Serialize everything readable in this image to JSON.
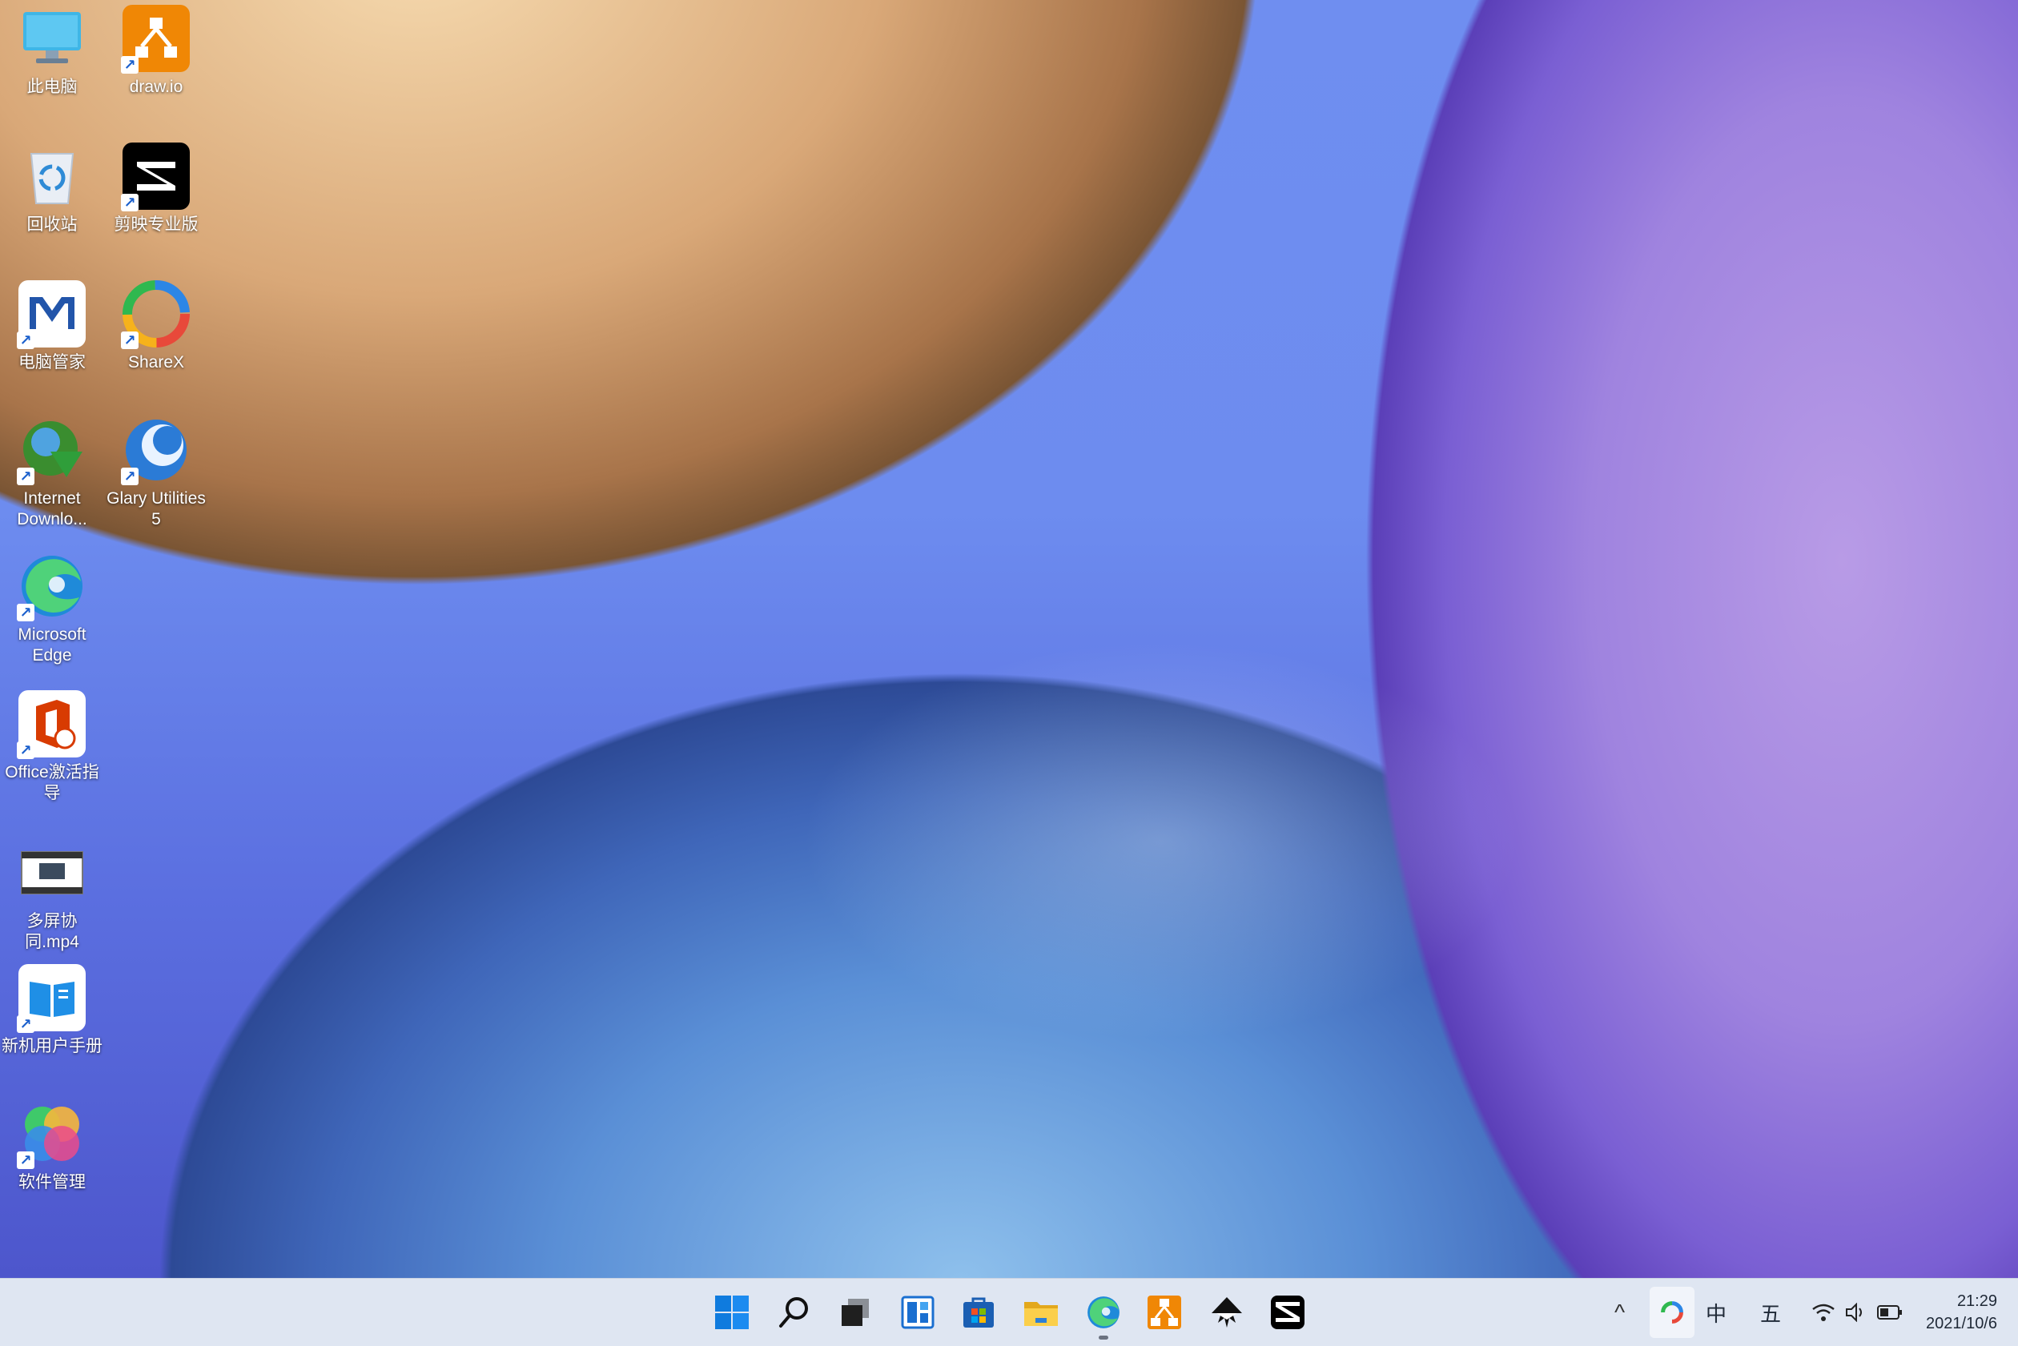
{
  "desktop": {
    "icons": [
      {
        "label": "此电脑",
        "icon": "this-pc-icon"
      },
      {
        "label": "draw.io",
        "icon": "drawio-icon"
      },
      {
        "label": "回收站",
        "icon": "recycle-bin-icon"
      },
      {
        "label": "剪映专业版",
        "icon": "capcut-icon"
      },
      {
        "label": "电脑管家",
        "icon": "pc-manager-icon"
      },
      {
        "label": "ShareX",
        "icon": "sharex-icon"
      },
      {
        "label": "Internet Downlo...",
        "icon": "internet-download-manager-icon"
      },
      {
        "label": "Glary Utilities 5",
        "icon": "glary-utilities-icon"
      },
      {
        "label": "Microsoft Edge",
        "icon": "edge-icon"
      },
      {
        "label": "Office激活指导",
        "icon": "office-icon"
      },
      {
        "label": "多屏协同.mp4",
        "icon": "video-file-icon"
      },
      {
        "label": "新机用户手册",
        "icon": "user-manual-icon"
      },
      {
        "label": "软件管理",
        "icon": "software-manager-icon"
      }
    ]
  },
  "taskbar": {
    "apps": [
      {
        "name": "start",
        "icon": "windows-start-icon"
      },
      {
        "name": "search",
        "icon": "search-icon"
      },
      {
        "name": "task-view",
        "icon": "task-view-icon"
      },
      {
        "name": "widgets",
        "icon": "widgets-icon"
      },
      {
        "name": "store",
        "icon": "microsoft-store-icon"
      },
      {
        "name": "file-explorer",
        "icon": "folder-icon"
      },
      {
        "name": "edge",
        "icon": "edge-icon"
      },
      {
        "name": "drawio",
        "icon": "drawio-icon"
      },
      {
        "name": "inkscape",
        "icon": "inkscape-icon"
      },
      {
        "name": "capcut",
        "icon": "capcut-icon"
      }
    ],
    "tray": {
      "chevron": "^",
      "ime_lang": "中",
      "ime_mode": "五",
      "time": "21:29",
      "date": "2021/10/6"
    }
  }
}
